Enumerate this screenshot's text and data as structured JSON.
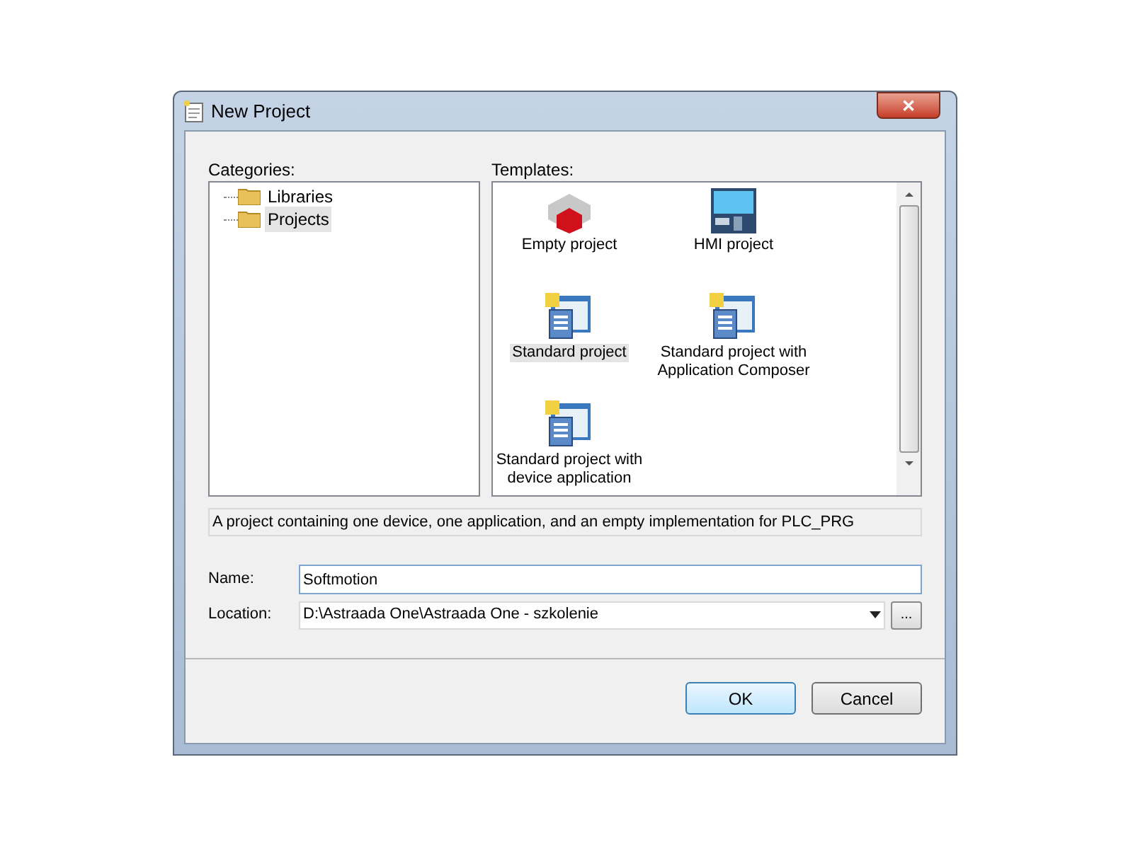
{
  "window": {
    "title": "New Project",
    "close": "✕"
  },
  "categories": {
    "label": "Categories:",
    "items": [
      {
        "label": "Libraries",
        "selected": false
      },
      {
        "label": "Projects",
        "selected": true
      }
    ]
  },
  "templates": {
    "label": "Templates:",
    "items": [
      {
        "label": "Empty project",
        "kind": "cube",
        "selected": false
      },
      {
        "label": "HMI project",
        "kind": "hmi",
        "selected": false
      },
      {
        "label": "Standard project",
        "kind": "standard",
        "selected": true
      },
      {
        "label": "Standard project with Application Composer",
        "kind": "standard",
        "selected": false
      },
      {
        "label": "Standard project with device application",
        "kind": "standard",
        "selected": false
      }
    ]
  },
  "description": "A project containing one device, one application, and an empty implementation for PLC_PRG",
  "name": {
    "label": "Name:",
    "value": "Softmotion"
  },
  "location": {
    "label": "Location:",
    "value": "D:\\Astraada One\\Astraada One - szkolenie",
    "browse": "..."
  },
  "buttons": [
    {
      "label": "OK",
      "default": true
    },
    {
      "label": "Cancel",
      "default": false
    }
  ]
}
